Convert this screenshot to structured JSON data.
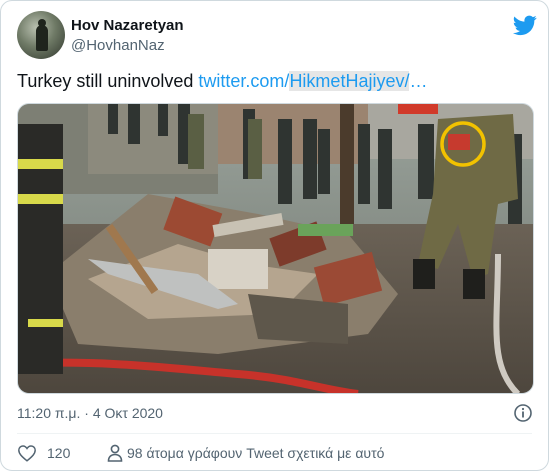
{
  "author": {
    "display_name": "Hov Nazaretyan",
    "handle": "@HovhanNaz"
  },
  "tweet": {
    "text": "Turkey still uninvolved ",
    "link_prefix": "twitter.com/",
    "link_highlight": "HikmetHajiyev/",
    "link_suffix": "…"
  },
  "media": {
    "kind": "photo",
    "highlight_circle_color": "#f2c200"
  },
  "meta": {
    "timestamp": "11:20 π.μ. · 4 Οκτ 2020"
  },
  "actions": {
    "like_count": "120",
    "talking_text": "98 άτομα γράφουν Tweet σχετικά με αυτό"
  },
  "colors": {
    "brand": "#1d9bf0",
    "secondary_text": "#536471",
    "primary_text": "#0f1419"
  },
  "icons": {
    "brand_logo": "twitter-bird-icon",
    "info": "info-icon",
    "like": "heart-icon",
    "talking": "person-icon"
  }
}
